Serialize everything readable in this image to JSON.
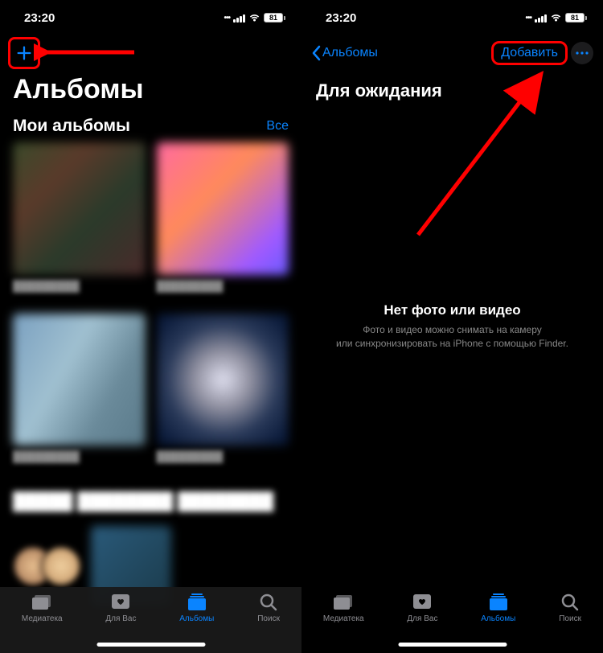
{
  "status": {
    "time": "23:20",
    "battery": "81"
  },
  "left": {
    "page_title": "Альбомы",
    "section_title": "Мои альбомы",
    "see_all": "Все",
    "tabs": {
      "library": "Медиатека",
      "for_you": "Для Вас",
      "albums": "Альбомы",
      "search": "Поиск"
    }
  },
  "right": {
    "back_label": "Альбомы",
    "add_label": "Добавить",
    "album_title": "Для ожидания",
    "empty_title": "Нет фото или видео",
    "empty_line1": "Фото и видео можно снимать на камеру",
    "empty_line2": "или синхронизировать на iPhone с помощью Finder.",
    "tabs": {
      "library": "Медиатека",
      "for_you": "Для Вас",
      "albums": "Альбомы",
      "search": "Поиск"
    }
  }
}
